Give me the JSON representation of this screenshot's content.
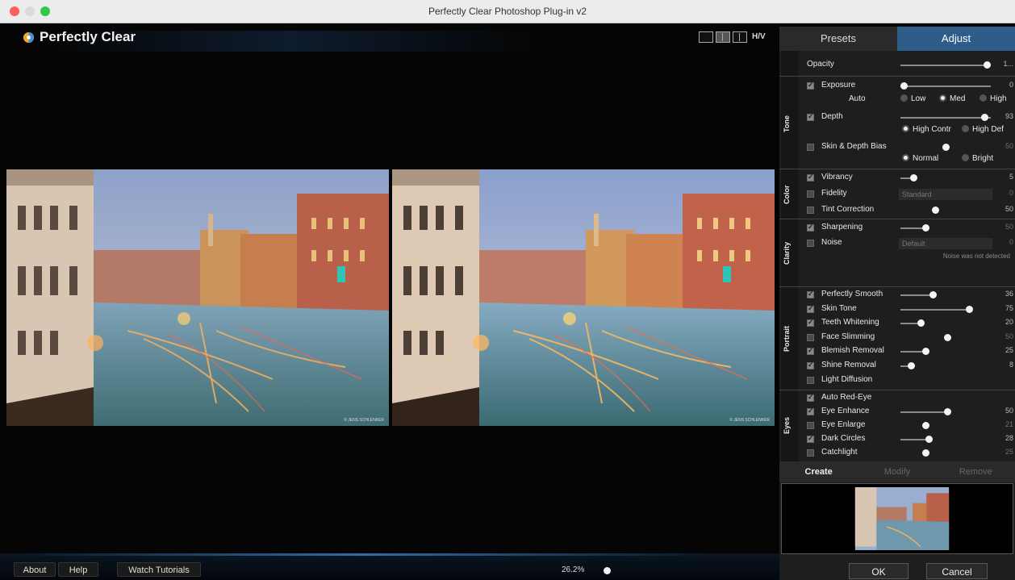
{
  "window": {
    "title": "Perfectly Clear Photoshop Plug-in v2"
  },
  "brand": {
    "name": "Perfectly Clear"
  },
  "view_toggle": {
    "hv_label": "H/V"
  },
  "photo": {
    "watermark": "© JENS SCHLENKER"
  },
  "bottom": {
    "about": "About",
    "help": "Help",
    "tutorials": "Watch Tutorials",
    "zoom": "26.2%"
  },
  "tabs": {
    "presets": "Presets",
    "adjust": "Adjust"
  },
  "opacity": {
    "label": "Opacity",
    "value": "1..."
  },
  "sections": {
    "tone": "Tone",
    "color": "Color",
    "clarity": "Clarity",
    "portrait": "Portrait",
    "eyes": "Eyes"
  },
  "tone": {
    "exposure": {
      "label": "Exposure",
      "value": "0",
      "checked": true,
      "level": 0.04
    },
    "auto": {
      "label": "Auto",
      "options": [
        "Low",
        "Med",
        "High"
      ],
      "selected": "Med"
    },
    "depth": {
      "label": "Depth",
      "value": "93",
      "checked": true,
      "level": 0.93
    },
    "depth_mode": {
      "options": [
        "High Contr",
        "High Def"
      ],
      "selected": "High Contr"
    },
    "skin_depth": {
      "label": "Skin & Depth Bias",
      "value": "50",
      "checked": false,
      "level": 0.5
    },
    "skin_mode": {
      "options": [
        "Normal",
        "Bright"
      ],
      "selected": "Normal"
    }
  },
  "color": {
    "vibrancy": {
      "label": "Vibrancy",
      "value": "5",
      "checked": true,
      "level": 0.14
    },
    "fidelity": {
      "label": "Fidelity",
      "dropdown": "Standard",
      "value": "0",
      "checked": false
    },
    "tint": {
      "label": "Tint Correction",
      "value": "50",
      "checked": false,
      "level": 0.38
    }
  },
  "clarity": {
    "sharpening": {
      "label": "Sharpening",
      "value": "50",
      "checked": true,
      "level": 0.28
    },
    "noise": {
      "label": "Noise",
      "dropdown": "Default",
      "value": "0",
      "checked": false
    },
    "noise_note": "Noise was not detected"
  },
  "portrait": [
    {
      "label": "Perfectly Smooth",
      "value": "36",
      "checked": true,
      "level": 0.36
    },
    {
      "label": "Skin Tone",
      "value": "75",
      "checked": true,
      "level": 0.76
    },
    {
      "label": "Teeth Whitening",
      "value": "20",
      "checked": true,
      "level": 0.22
    },
    {
      "label": "Face Slimming",
      "value": "50",
      "checked": false,
      "level": 0.52
    },
    {
      "label": "Blemish Removal",
      "value": "25",
      "checked": true,
      "level": 0.28
    },
    {
      "label": "Shine Removal",
      "value": "8",
      "checked": true,
      "level": 0.12
    },
    {
      "label": "Light Diffusion",
      "value": "",
      "checked": false,
      "level": null
    }
  ],
  "eyes": [
    {
      "label": "Auto Red-Eye",
      "value": "",
      "checked": true,
      "level": null
    },
    {
      "label": "Eye Enhance",
      "value": "50",
      "checked": true,
      "level": 0.52
    },
    {
      "label": "Eye Enlarge",
      "value": "21",
      "checked": false,
      "level": 0.28
    },
    {
      "label": "Dark Circles",
      "value": "28",
      "checked": true,
      "level": 0.31
    },
    {
      "label": "Catchlight",
      "value": "25",
      "checked": false,
      "level": 0.28
    }
  ],
  "profile_tabs": {
    "create": "Create",
    "modify": "Modify",
    "remove": "Remove"
  },
  "dialog": {
    "ok": "OK",
    "cancel": "Cancel"
  },
  "colors": {
    "accent": "#2e5d8a",
    "panel": "#1e1e1e",
    "background": "#050505"
  }
}
